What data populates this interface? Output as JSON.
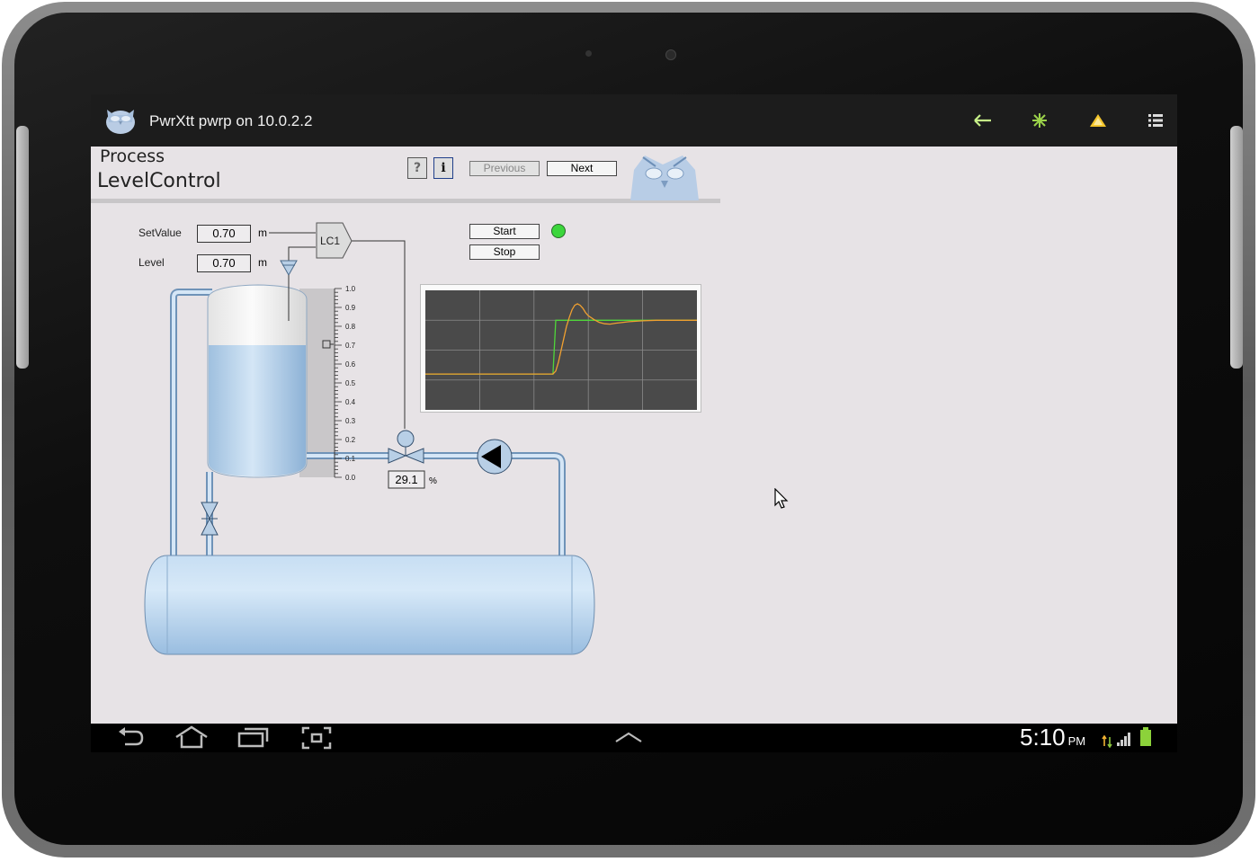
{
  "app": {
    "title": "PwrXtt pwrp on 10.0.2.2",
    "action_icons": [
      "back-arrow-icon",
      "asterisk-icon",
      "alarm-triangle-icon",
      "menu-list-icon"
    ]
  },
  "header": {
    "process_label": "Process",
    "graph_title": "LevelControl",
    "help_label": "?",
    "info_label": "i",
    "previous_label": "Previous",
    "next_label": "Next"
  },
  "controls": {
    "setvalue_label": "SetValue",
    "setvalue_value": "0.70",
    "setvalue_unit": "m",
    "level_label": "Level",
    "level_value": "0.70",
    "level_unit": "m",
    "controller_label": "LC1",
    "start_label": "Start",
    "stop_label": "Stop",
    "status_color": "#3cd63c",
    "valve_value": "29.1",
    "valve_unit": "%"
  },
  "scale": {
    "ticks": [
      "1.0",
      "0.9",
      "0.8",
      "0.7",
      "0.6",
      "0.5",
      "0.4",
      "0.3",
      "0.2",
      "0.1",
      "0.0"
    ],
    "tank_level": 0.7
  },
  "chart_data": {
    "type": "line",
    "title": "",
    "xlabel": "",
    "ylabel": "",
    "grid": true,
    "x": [
      0,
      10,
      20,
      30,
      40,
      47,
      48,
      49,
      50,
      51,
      52,
      53,
      54,
      55,
      56,
      57,
      58,
      59,
      60,
      62,
      64,
      66,
      68,
      70,
      75,
      80,
      85,
      90,
      100
    ],
    "series": [
      {
        "color": "#4fd63a",
        "values": [
          0.52,
          0.52,
          0.52,
          0.52,
          0.52,
          0.52,
          0.7,
          0.7,
          0.7,
          0.7,
          0.7,
          0.7,
          0.7,
          0.7,
          0.7,
          0.7,
          0.7,
          0.7,
          0.7,
          0.7,
          0.7,
          0.7,
          0.7,
          0.7,
          0.7,
          0.7,
          0.7,
          0.7,
          0.7
        ]
      },
      {
        "color": "#f0a030",
        "values": [
          0.52,
          0.52,
          0.52,
          0.52,
          0.52,
          0.52,
          0.53,
          0.56,
          0.6,
          0.64,
          0.68,
          0.71,
          0.735,
          0.75,
          0.755,
          0.75,
          0.74,
          0.725,
          0.715,
          0.703,
          0.693,
          0.688,
          0.687,
          0.69,
          0.695,
          0.698,
          0.7,
          0.7,
          0.7
        ]
      }
    ],
    "ylim": [
      0.4,
      0.8
    ],
    "colors": {
      "background": "#4a4a4a",
      "grid": "#8a8a8a"
    }
  },
  "statusbar": {
    "time": "5:10",
    "ampm": "PM",
    "nav_icons": [
      "back-icon",
      "home-icon",
      "recent-apps-icon",
      "screenshot-icon",
      "up-chevron-icon"
    ]
  }
}
